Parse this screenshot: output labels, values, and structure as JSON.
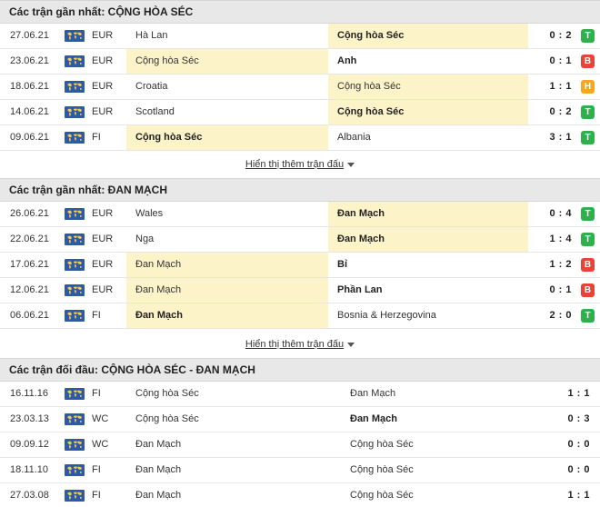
{
  "sections": [
    {
      "title": "Các trận gần nhất: CỘNG HÒA SÉC",
      "more_label": "Hiển thị thêm trận đấu",
      "rows": [
        {
          "date": "27.06.21",
          "comp": "EUR",
          "home": "Hà Lan",
          "away": "Cộng hòa Séc",
          "score": "0 : 2",
          "result": "T",
          "highlight": "away",
          "winner": "away"
        },
        {
          "date": "23.06.21",
          "comp": "EUR",
          "home": "Cộng hòa Séc",
          "away": "Anh",
          "score": "0 : 1",
          "result": "B",
          "highlight": "home",
          "winner": "away"
        },
        {
          "date": "18.06.21",
          "comp": "EUR",
          "home": "Croatia",
          "away": "Cộng hòa Séc",
          "score": "1 : 1",
          "result": "H",
          "highlight": "away",
          "winner": ""
        },
        {
          "date": "14.06.21",
          "comp": "EUR",
          "home": "Scotland",
          "away": "Cộng hòa Séc",
          "score": "0 : 2",
          "result": "T",
          "highlight": "away",
          "winner": "away"
        },
        {
          "date": "09.06.21",
          "comp": "FI",
          "home": "Cộng hòa Séc",
          "away": "Albania",
          "score": "3 : 1",
          "result": "T",
          "highlight": "home",
          "winner": "home"
        }
      ]
    },
    {
      "title": "Các trận gần nhất: ĐAN MẠCH",
      "more_label": "Hiển thị thêm trận đấu",
      "rows": [
        {
          "date": "26.06.21",
          "comp": "EUR",
          "home": "Wales",
          "away": "Đan Mạch",
          "score": "0 : 4",
          "result": "T",
          "highlight": "away",
          "winner": "away"
        },
        {
          "date": "22.06.21",
          "comp": "EUR",
          "home": "Nga",
          "away": "Đan Mạch",
          "score": "1 : 4",
          "result": "T",
          "highlight": "away",
          "winner": "away"
        },
        {
          "date": "17.06.21",
          "comp": "EUR",
          "home": "Đan Mạch",
          "away": "Bỉ",
          "score": "1 : 2",
          "result": "B",
          "highlight": "home",
          "winner": "away"
        },
        {
          "date": "12.06.21",
          "comp": "EUR",
          "home": "Đan Mạch",
          "away": "Phần Lan",
          "score": "0 : 1",
          "result": "B",
          "highlight": "home",
          "winner": "away"
        },
        {
          "date": "06.06.21",
          "comp": "FI",
          "home": "Đan Mạch",
          "away": "Bosnia & Herzegovina",
          "score": "2 : 0",
          "result": "T",
          "highlight": "home",
          "winner": "home"
        }
      ]
    }
  ],
  "h2h": {
    "title": "Các trận đối đầu: CỘNG HÒA SÉC - ĐAN MẠCH",
    "rows": [
      {
        "date": "16.11.16",
        "comp": "FI",
        "home": "Cộng hòa Séc",
        "away": "Đan Mạch",
        "score": "1 : 1",
        "winner": ""
      },
      {
        "date": "23.03.13",
        "comp": "WC",
        "home": "Cộng hòa Séc",
        "away": "Đan Mạch",
        "score": "0 : 3",
        "winner": "away"
      },
      {
        "date": "09.09.12",
        "comp": "WC",
        "home": "Đan Mạch",
        "away": "Cộng hòa Séc",
        "score": "0 : 0",
        "winner": ""
      },
      {
        "date": "18.11.10",
        "comp": "FI",
        "home": "Đan Mạch",
        "away": "Cộng hòa Séc",
        "score": "0 : 0",
        "winner": ""
      },
      {
        "date": "27.03.08",
        "comp": "FI",
        "home": "Đan Mạch",
        "away": "Cộng hòa Séc",
        "score": "1 : 1",
        "winner": ""
      }
    ]
  },
  "colors": {
    "win": "#2fb04b",
    "loss": "#e64437",
    "draw": "#f5a623",
    "highlight": "#fdf3c8",
    "header_bg": "#e8e8e8"
  },
  "icons": {
    "competition": "world-map-icon",
    "more": "caret-down-icon"
  }
}
